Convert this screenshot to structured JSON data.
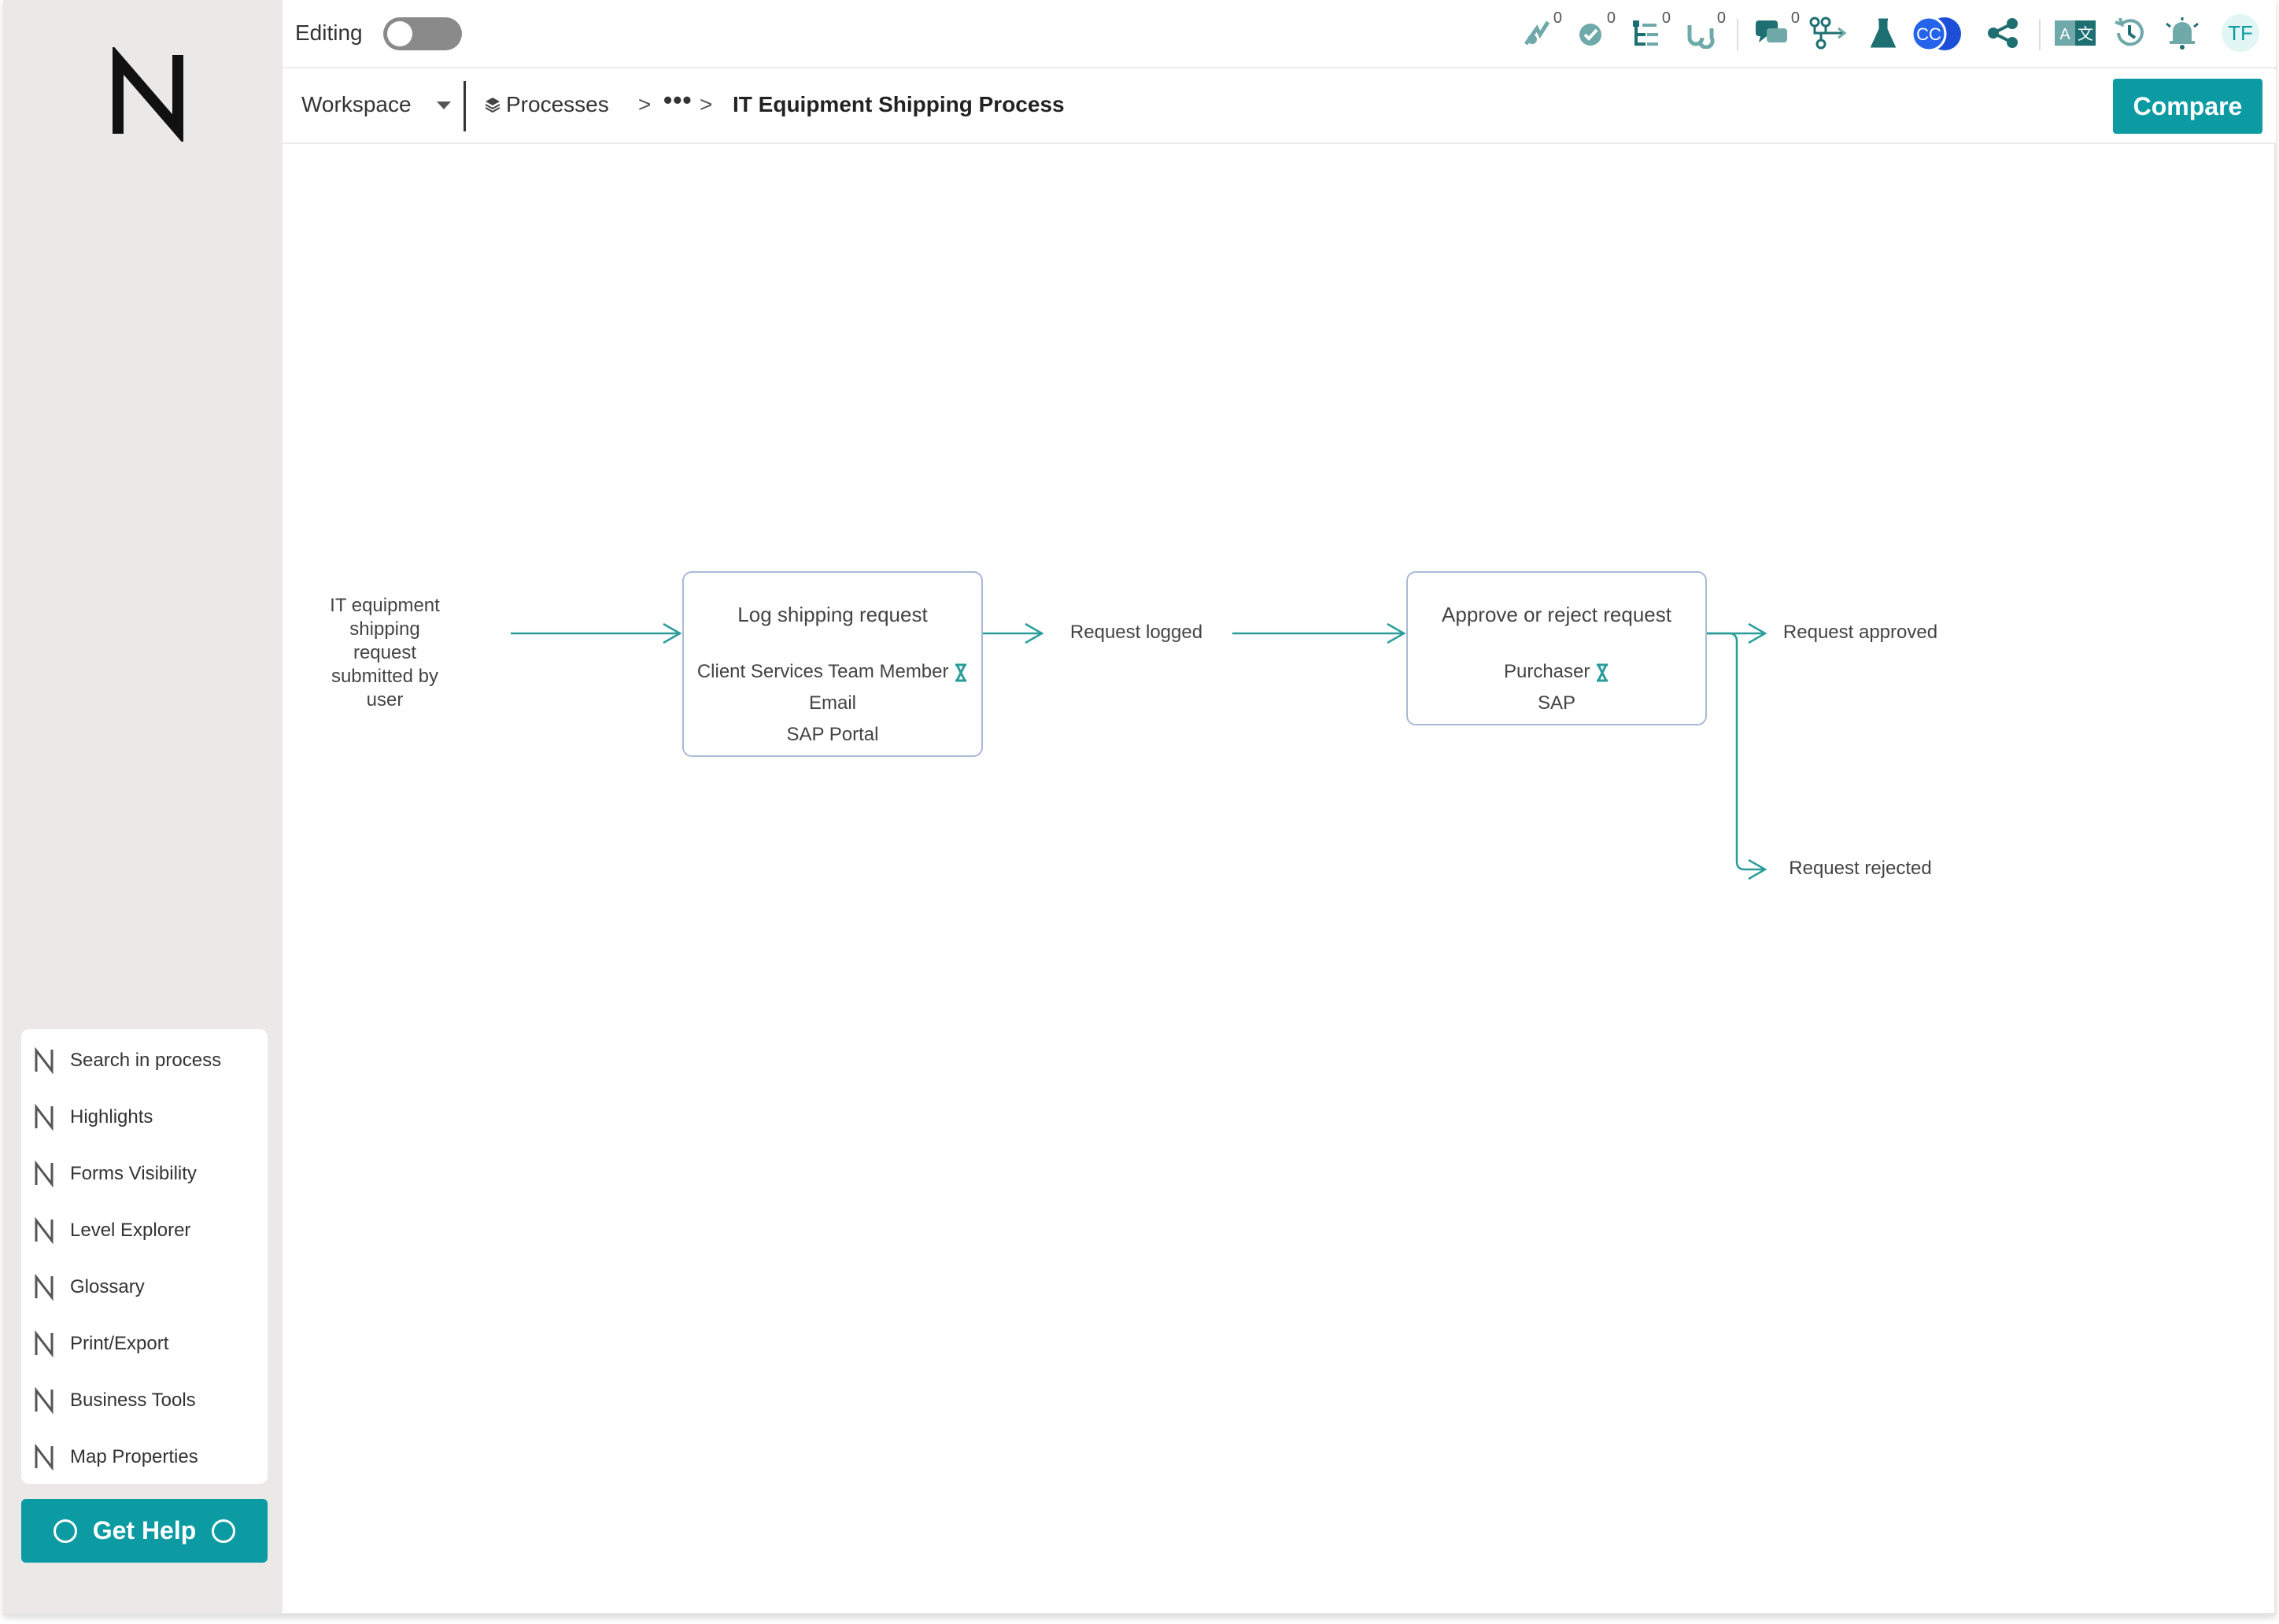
{
  "topbar": {
    "editing_label": "Editing",
    "editing_on": false,
    "badges": [
      "0",
      "0",
      "0",
      "0",
      "0"
    ],
    "avatar_cc": "CC",
    "user_initials": "TF",
    "accent": "#0c9ba3"
  },
  "breadcrumb": {
    "workspace": "Workspace",
    "processes": "Processes",
    "ellipsis": "•••",
    "separator": ">",
    "current": "IT Equipment Shipping Process",
    "compare_label": "Compare"
  },
  "sidebar": {
    "tools": [
      {
        "label": "Search in process"
      },
      {
        "label": "Highlights"
      },
      {
        "label": "Forms Visibility"
      },
      {
        "label": "Level Explorer"
      },
      {
        "label": "Glossary"
      },
      {
        "label": "Print/Export"
      },
      {
        "label": "Business Tools"
      },
      {
        "label": "Map Properties"
      }
    ],
    "help_label": "Get Help"
  },
  "process_map": {
    "trigger": [
      "IT equipment",
      "shipping request",
      "submitted by user"
    ],
    "activity_1": {
      "title": "Log shipping request",
      "resources": [
        "Client Services Team Member",
        "Email",
        "SAP Portal"
      ]
    },
    "output_1": "Request logged",
    "activity_2": {
      "title": "Approve or reject request",
      "resources": [
        "Purchaser",
        "SAP"
      ]
    },
    "output_approved": "Request approved",
    "output_rejected": "Request rejected",
    "line_color": "#2a9d9a",
    "box_border": "#a9b9d6"
  }
}
